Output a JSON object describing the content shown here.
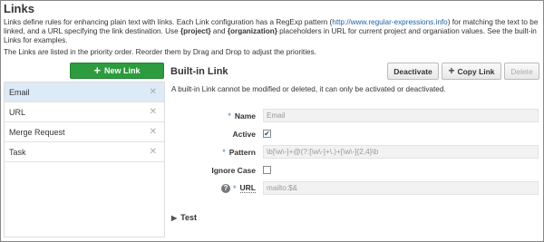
{
  "page": {
    "title": "Links",
    "description": {
      "part1": "Links define rules for enhancing plain text with links. Each Link configuration has a RegExp pattern (",
      "link": "http://www.regular-expressions.info",
      "part2": ") for matching the text to be linked, and a URL specifying the link destination. Use ",
      "ph1": "{project}",
      "part3": " and ",
      "ph2": "{organization}",
      "part4": " placeholders in URL for current project and organiation values. See the built-in Links for examples."
    },
    "order_note": "The Links are listed in the priority order. Reorder them by Drag and Drop to adjust the priorities."
  },
  "sidebar": {
    "new_link_label": "New Link",
    "items": [
      {
        "label": "Email",
        "selected": true
      },
      {
        "label": "URL"
      },
      {
        "label": "Merge Request"
      },
      {
        "label": "Task"
      }
    ],
    "remove_glyph": "✕"
  },
  "detail": {
    "title": "Built-in Link",
    "toolbar": {
      "deactivate_label": "Deactivate",
      "copy_label": "Copy Link",
      "delete_label": "Delete"
    },
    "note": "A built-in Link cannot be modified or deleted, it can only be activated or deactivated.",
    "fields": {
      "name_label": "Name",
      "name_value": "Email",
      "active_label": "Active",
      "active_checked": true,
      "pattern_label": "Pattern",
      "pattern_value": "\\b[\\w\\-]+@(?:[\\w\\-]+\\.)+[\\w\\-]{2,4}\\b",
      "ignore_case_label": "Ignore Case",
      "ignore_case_checked": false,
      "url_label": "URL",
      "url_value": "mailto:$&"
    },
    "test_label": "Test"
  },
  "icons": {
    "plus": "plus-icon",
    "remove": "close-icon",
    "help": "help-icon",
    "checkbox_checked": "checkmark-icon",
    "expand": "triangle-right-icon"
  },
  "colors": {
    "new_link_bg": "#2c9c3e",
    "selected_row": "#ddeaf7",
    "required_marker": "#3a7fc4",
    "link": "#1a5fa8"
  }
}
